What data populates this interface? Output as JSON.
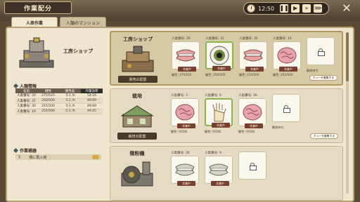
{
  "header": {
    "title": "作業配分",
    "time": "12:50"
  },
  "tabs": [
    {
      "label": "人类作業"
    },
    {
      "label": "人類のマンション"
    }
  ],
  "left": {
    "shop_name": "工房ショップ",
    "info_heading": "人類情報",
    "columns": [
      "名前",
      "健性",
      "健性差",
      "作業効率"
    ],
    "rows": [
      [
        "人类番号: 20",
        "275/525",
        "-5.1 /h",
        "54:34"
      ],
      [
        "人类番号: 31",
        "250/500",
        "-5.1 /h",
        "49:09"
      ],
      [
        "人类番号: 30",
        "215/500",
        "-5.1 /h",
        "49:09"
      ],
      [
        "人类番号: 19",
        "252/500",
        "-5.1 /h",
        "49:25"
      ]
    ],
    "tools_heading": "作業補器",
    "tool_item": {
      "num": "1",
      "label": "畑に再入荷"
    }
  },
  "cards": [
    {
      "name": "工房ショップ",
      "place_label": "販売の配置",
      "queue_label": "キューを編集する",
      "slots": [
        {
          "num": "人类番号: 20",
          "tag": "作業中",
          "stat": "健性: 275/525",
          "icon": "teeth-icon"
        },
        {
          "num": "人类番号: 31",
          "tag": "作業中",
          "stat": "健性: 250/500",
          "icon": "eyeball-icon"
        },
        {
          "num": "人类番号: 30",
          "tag": "作業中",
          "stat": "健性: 215/500",
          "icon": "teeth-icon"
        },
        {
          "num": "人类番号: 19",
          "tag": "作業中",
          "stat": "健性: 252/500",
          "icon": "brain-icon"
        },
        {
          "num": "",
          "tag": "",
          "stat": "解放待ち",
          "icon": "lock-icon"
        }
      ]
    },
    {
      "name": "栽培",
      "place_label": "栽培の配置",
      "queue_label": "キューを編集する",
      "slots": [
        {
          "num": "人类番号: 3",
          "tag": "作業中",
          "stat": "健性: 0/500",
          "icon": "brain-icon"
        },
        {
          "num": "人类番号: 6",
          "tag": "作業中",
          "stat": "健性: 0/500",
          "icon": "hand-icon"
        },
        {
          "num": "人类番号: 16",
          "tag": "作業中",
          "stat": "健性: 0/500",
          "icon": "brain-icon"
        },
        {
          "num": "",
          "tag": "",
          "stat": "解放待ち",
          "icon": "lock-icon"
        }
      ]
    },
    {
      "name": "微粉機",
      "place_label": "",
      "queue_label": "",
      "slots": [
        {
          "num": "人类番号: 26",
          "tag": "作業中",
          "stat": "健性: 0/500",
          "icon": "teeth-icon"
        },
        {
          "num": "人类番号: 9",
          "tag": "作業中",
          "stat": "健性: 0/500",
          "icon": "teeth-icon"
        },
        {
          "num": "",
          "tag": "",
          "stat": "",
          "icon": "lock-icon"
        }
      ]
    }
  ]
}
